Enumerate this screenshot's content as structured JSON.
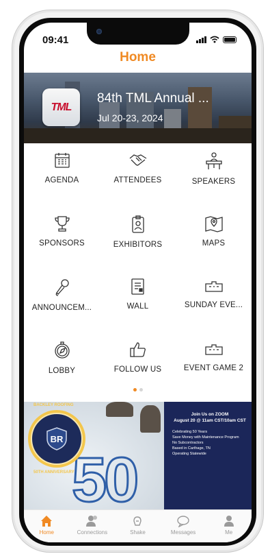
{
  "status_bar": {
    "time": "09:41"
  },
  "header": {
    "title": "Home"
  },
  "banner": {
    "logo_text": "TML",
    "title": "84th TML Annual ...",
    "dates": "Jul 20-23, 2024"
  },
  "menu": {
    "items": [
      {
        "label": "AGENDA",
        "icon": "calendar-icon"
      },
      {
        "label": "ATTENDEES",
        "icon": "handshake-icon"
      },
      {
        "label": "SPEAKERS",
        "icon": "podium-speaker-icon"
      },
      {
        "label": "SPONSORS",
        "icon": "trophy-icon"
      },
      {
        "label": "EXHIBITORS",
        "icon": "id-badge-icon"
      },
      {
        "label": "MAPS",
        "icon": "map-pin-icon"
      },
      {
        "label": "ANNOUNCEM...",
        "icon": "microphone-icon"
      },
      {
        "label": "WALL",
        "icon": "document-list-icon"
      },
      {
        "label": "SUNDAY EVE...",
        "icon": "ticket-icon"
      },
      {
        "label": "LOBBY",
        "icon": "compass-icon"
      },
      {
        "label": "FOLLOW US",
        "icon": "thumbs-up-icon"
      },
      {
        "label": "EVENT GAME 2",
        "icon": "ticket-icon"
      }
    ],
    "page_indicator": {
      "current": 1,
      "total": 2
    }
  },
  "promo": {
    "badge_top": "BACKLEY ROOFING",
    "badge_bottom": "50TH ANNIVERSARY",
    "photo_number": "50",
    "headline": "Join Us on ZOOM",
    "headline_time": "August 20 @ 11am CST/10am CST",
    "lines": [
      "Celebrating 50 Years",
      "Save Money with Maintenance Program",
      "No Subcontractors"
    ],
    "location_lines": [
      "Based in Carthage, TN",
      "Operating Statewide"
    ]
  },
  "tabbar": {
    "items": [
      {
        "label": "Home",
        "icon": "home-icon",
        "active": true
      },
      {
        "label": "Connections",
        "icon": "people-icon",
        "active": false
      },
      {
        "label": "Shake",
        "icon": "shake-icon",
        "active": false
      },
      {
        "label": "Messages",
        "icon": "chat-bubble-icon",
        "active": false
      },
      {
        "label": "Me",
        "icon": "person-icon",
        "active": false
      }
    ]
  },
  "colors": {
    "accent": "#f08a24",
    "promo_panel": "#1b2659"
  }
}
